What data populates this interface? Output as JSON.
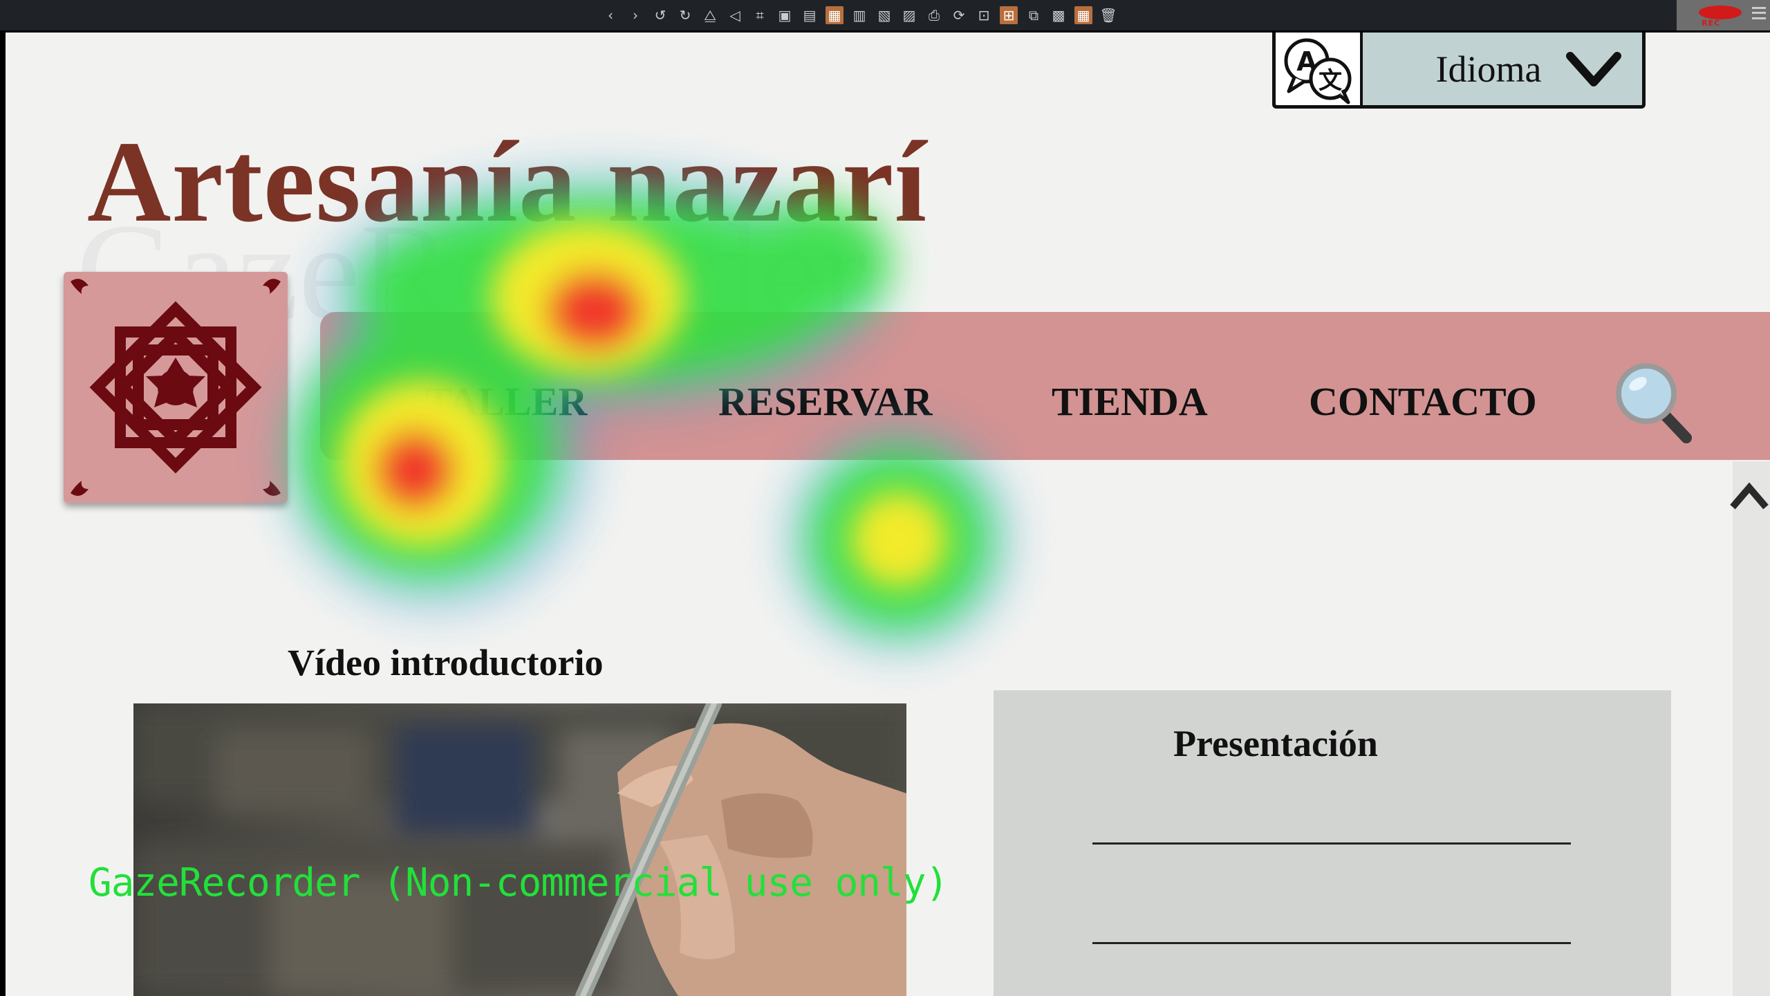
{
  "toolbar": {
    "icons": [
      "back-icon",
      "forward-icon",
      "undo-icon",
      "redo-icon",
      "flip-icon",
      "rotate-icon",
      "crop-icon",
      "frame-icon",
      "image-icon",
      "active-image-icon",
      "grid-image-icon",
      "layout-icon",
      "layout-alt-icon",
      "print-icon",
      "refresh-icon",
      "resize-icon",
      "active-resize-icon",
      "gallery-icon",
      "picture-icon",
      "active-grid-icon",
      "trash-icon"
    ],
    "record_label": "REC"
  },
  "header": {
    "language_label": "Idioma",
    "site_title": "Artesanía nazarí",
    "watermark_text": "GazeRecorder"
  },
  "nav": {
    "items": [
      "TALLER",
      "RESERVAR",
      "TIENDA",
      "CONTACTO"
    ]
  },
  "main": {
    "video_title": "Vídeo introductorio",
    "presentation_title": "Presentación"
  },
  "overlay": {
    "recorder_notice": "GazeRecorder (Non-commercial use only)"
  },
  "colors": {
    "title": "#7b3326",
    "navbar": "#d39393",
    "language_box": "#c0d3d2",
    "logo_tile": "#d6999a",
    "logo_pattern": "#6b0a10"
  }
}
